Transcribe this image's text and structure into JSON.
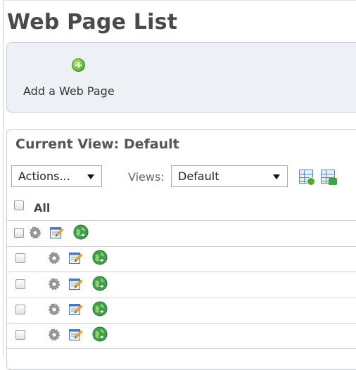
{
  "page": {
    "title": "Web Page List"
  },
  "toolbar": {
    "add_label": "Add a Web Page",
    "add_icon": "add-circle-icon"
  },
  "list": {
    "current_view_label": "Current View: Default",
    "actions_select": {
      "selected": "Actions..."
    },
    "views_label": "Views:",
    "views_select": {
      "selected": "Default"
    },
    "header_icons": [
      "add-view-icon",
      "switch-view-icon"
    ],
    "select_all_label": "All",
    "rows": [
      {
        "checked": false,
        "icons": [
          "settings-gear-icon",
          "edit-page-icon",
          "view-page-globe-icon"
        ]
      },
      {
        "checked": false,
        "icons": [
          "settings-gear-icon",
          "edit-page-icon",
          "view-page-globe-icon"
        ]
      },
      {
        "checked": false,
        "icons": [
          "settings-gear-icon",
          "edit-page-icon",
          "view-page-globe-icon"
        ]
      },
      {
        "checked": false,
        "icons": [
          "settings-gear-icon",
          "edit-page-icon",
          "view-page-globe-icon"
        ]
      },
      {
        "checked": false,
        "icons": [
          "settings-gear-icon",
          "edit-page-icon",
          "view-page-globe-icon"
        ]
      }
    ]
  },
  "colors": {
    "title": "#4a4a4a",
    "panel_bg": "#edf0f5",
    "add_green": "#6cc23a"
  }
}
